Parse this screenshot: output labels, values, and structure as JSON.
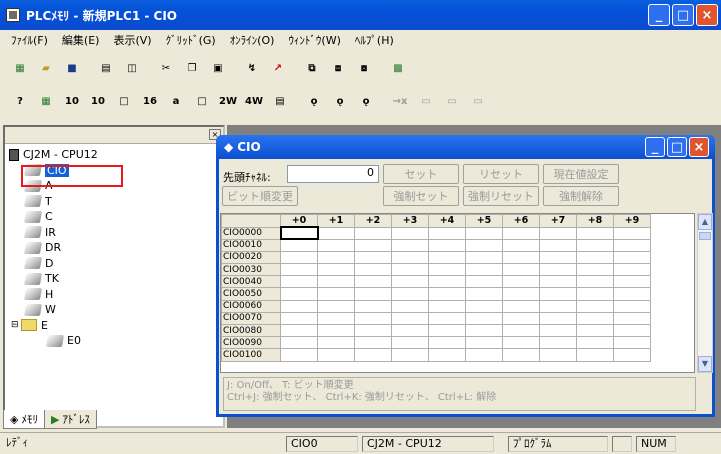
{
  "window": {
    "title": "PLCﾒﾓﾘ - 新規PLC1 - CIO"
  },
  "menu": [
    "ﾌｧｲﾙ(F)",
    "編集(E)",
    "表示(V)",
    "ｸﾞﾘｯﾄﾞ(G)",
    "ｵﾝﾗｲﾝ(O)",
    "ｳｨﾝﾄﾞｳ(W)",
    "ﾍﾙﾌﾟ(H)"
  ],
  "toolbar2": {
    "icons": [
      "?",
      "▦",
      "10",
      "10",
      "□",
      "16",
      "a",
      "□",
      "2W",
      "4W",
      "▤",
      "ǫ",
      "ǫ",
      "ǫ",
      "→x",
      "▭",
      "▭",
      "▭"
    ]
  },
  "tree": {
    "root": "CJ2M - CPU12",
    "areas": [
      "CIO",
      "A",
      "T",
      "C",
      "IR",
      "DR",
      "D",
      "TK",
      "H",
      "W",
      "E"
    ],
    "sub": "E0"
  },
  "tabs": {
    "memory": "ﾒﾓﾘ",
    "address": "ｱﾄﾞﾚｽ"
  },
  "child": {
    "title": "CIO",
    "start_label": "先頭ﾁｬﾈﾙ:",
    "start_value": "0",
    "btn_set": "セット",
    "btn_reset": "リセット",
    "btn_cur": "現在値設定",
    "btn_bitorder": "ビット順変更",
    "btn_force_set": "強制セット",
    "btn_force_reset": "強制リセット",
    "btn_force_release": "強制解除",
    "cols": [
      "+0",
      "+1",
      "+2",
      "+3",
      "+4",
      "+5",
      "+6",
      "+7",
      "+8",
      "+9"
    ],
    "rows": [
      "CIO0000",
      "CIO0010",
      "CIO0020",
      "CIO0030",
      "CIO0040",
      "CIO0050",
      "CIO0060",
      "CIO0070",
      "CIO0080",
      "CIO0090",
      "CIO0100"
    ],
    "hint1": "J: On/Off、 T: ビット順変更",
    "hint2": "Ctrl+J: 強制セット、 Ctrl+K: 強制リセット、 Ctrl+L: 解除"
  },
  "status": {
    "ready": "ﾚﾃﾞｨ",
    "area": "CIO0",
    "model": "CJ2M - CPU12",
    "mode": "ﾌﾟﾛｸﾞﾗﾑ",
    "num": "NUM"
  }
}
